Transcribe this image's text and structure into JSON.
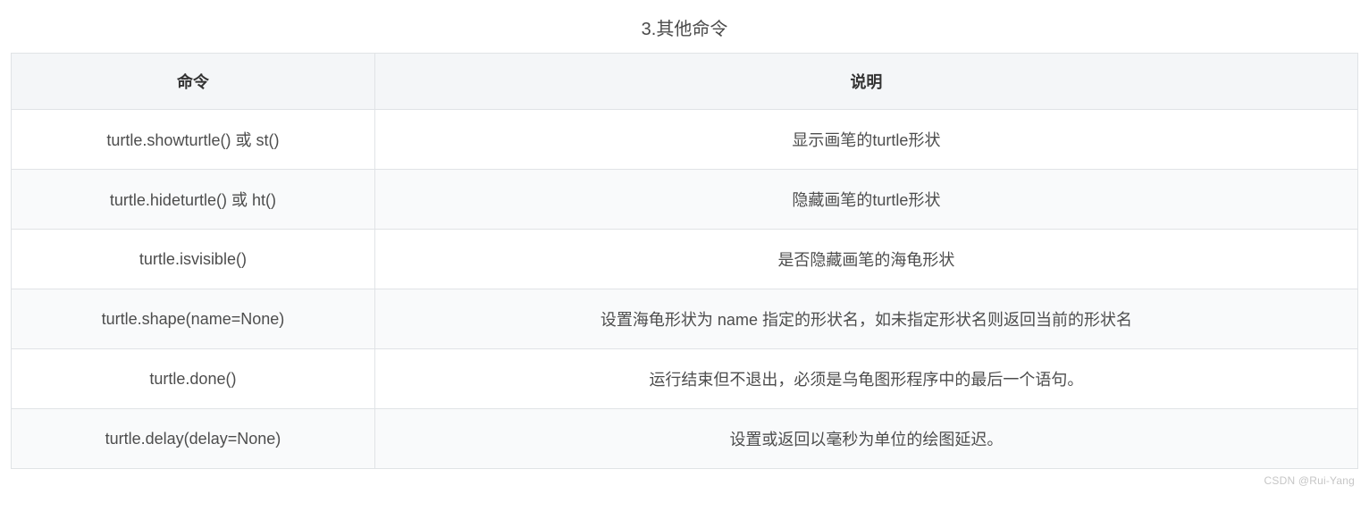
{
  "title": "3.其他命令",
  "headers": {
    "command": "命令",
    "description": "说明"
  },
  "rows": [
    {
      "command": "turtle.showturtle() 或 st()",
      "description": "显示画笔的turtle形状"
    },
    {
      "command": "turtle.hideturtle() 或 ht()",
      "description": "隐藏画笔的turtle形状"
    },
    {
      "command": "turtle.isvisible()",
      "description": "是否隐藏画笔的海龟形状"
    },
    {
      "command": "turtle.shape(name=None)",
      "description": "设置海龟形状为 name 指定的形状名，如未指定形状名则返回当前的形状名"
    },
    {
      "command": "turtle.done()",
      "description": "运行结束但不退出，必须是乌龟图形程序中的最后一个语句。"
    },
    {
      "command": "turtle.delay(delay=None)",
      "description": "设置或返回以毫秒为单位的绘图延迟。"
    }
  ],
  "watermark": "CSDN @Rui-Yang"
}
